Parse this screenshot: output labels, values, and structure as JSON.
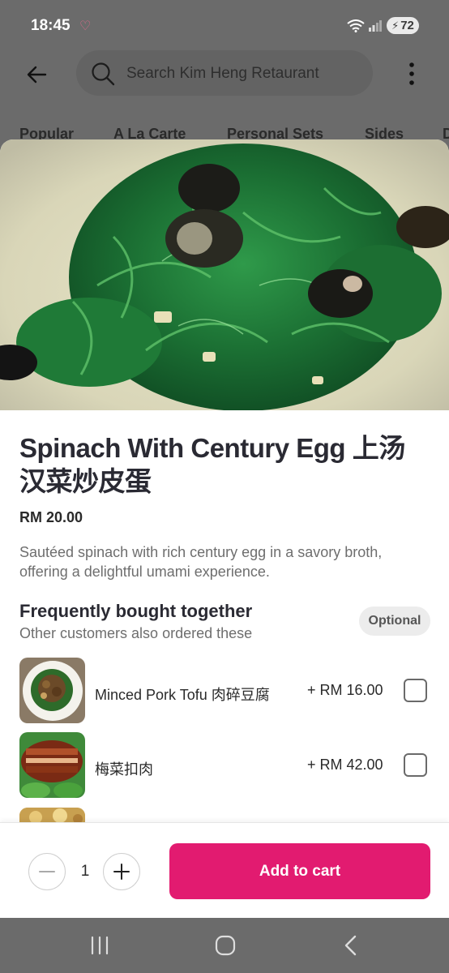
{
  "status": {
    "time": "18:45",
    "battery": "72"
  },
  "header": {
    "search_placeholder": "Search Kim Heng Retaurant"
  },
  "tabs": [
    {
      "label": "Popular"
    },
    {
      "label": "A La Carte"
    },
    {
      "label": "Personal Sets"
    },
    {
      "label": "Sides"
    },
    {
      "label": "D"
    }
  ],
  "product": {
    "title": "Spinach With Century Egg 上汤汉菜炒皮蛋",
    "price": "RM 20.00",
    "description": "Sautéed spinach with rich century egg in a savory broth, offering a delightful umami experience."
  },
  "fbt": {
    "title": "Frequently bought together",
    "subtitle": "Other customers also ordered these",
    "badge": "Optional",
    "items": [
      {
        "name": "Minced Pork Tofu 肉碎豆腐",
        "price": "+ RM 16.00",
        "checked": false
      },
      {
        "name": "梅菜扣肉",
        "price": "+ RM 42.00",
        "checked": false
      }
    ]
  },
  "cart": {
    "quantity": "1",
    "add_label": "Add to cart"
  },
  "colors": {
    "accent": "#e21b70"
  }
}
